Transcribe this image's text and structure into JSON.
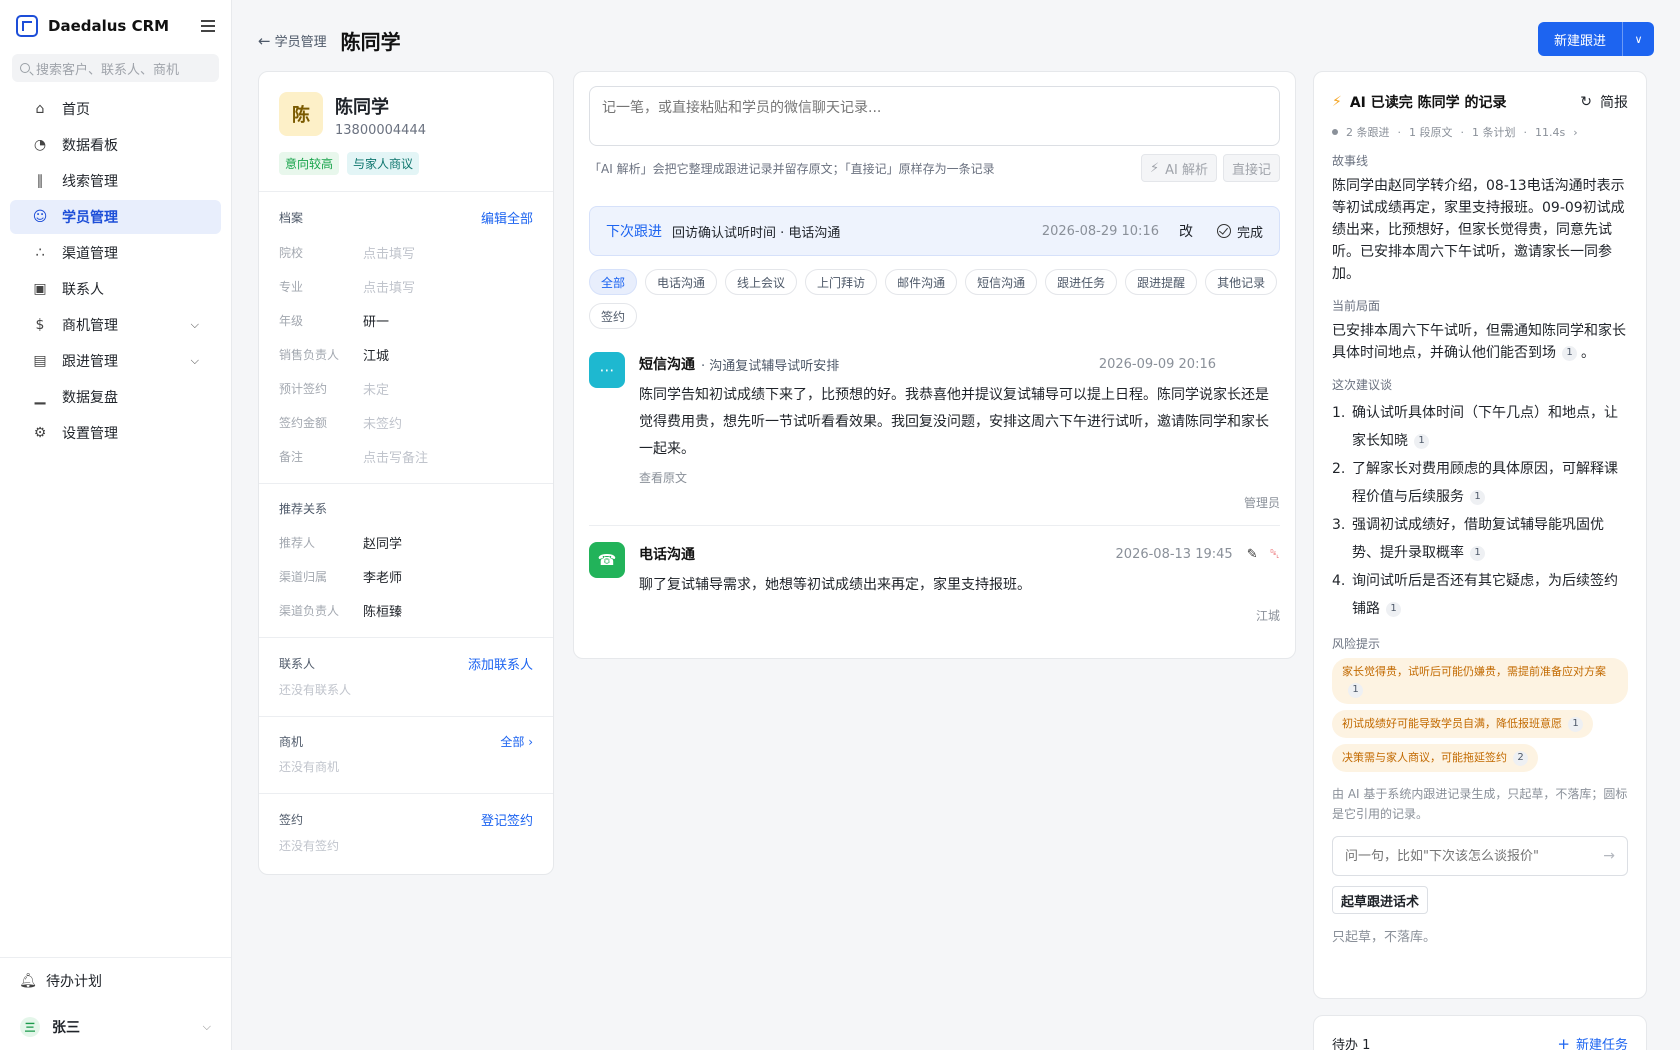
{
  "app": {
    "name": "Daedalus CRM"
  },
  "sidebar": {
    "search_placeholder": "搜索客户、联系人、商机",
    "items": [
      {
        "label": "首页",
        "icon": "home-icon"
      },
      {
        "label": "数据看板",
        "icon": "dashboard-icon"
      },
      {
        "label": "线索管理",
        "icon": "share-icon"
      },
      {
        "label": "学员管理",
        "icon": "users-icon",
        "active": true
      },
      {
        "label": "渠道管理",
        "icon": "network-icon"
      },
      {
        "label": "联系人",
        "icon": "contact-icon"
      },
      {
        "label": "商机管理",
        "icon": "dollar-icon",
        "expandable": true
      },
      {
        "label": "跟进管理",
        "icon": "clipboard-icon",
        "expandable": true
      },
      {
        "label": "数据复盘",
        "icon": "bar-chart-icon"
      },
      {
        "label": "设置管理",
        "icon": "gear-icon"
      }
    ],
    "todo_plan": "待办计划",
    "user": {
      "avatar": "三",
      "name": "张三"
    }
  },
  "header": {
    "back_label": "学员管理",
    "title": "陈同学",
    "new_button": "新建跟进"
  },
  "profile": {
    "avatar": "陈",
    "name": "陈同学",
    "phone": "13800004444",
    "tags": [
      "意向较高",
      "与家人商议"
    ],
    "archive": {
      "title": "档案",
      "edit_link": "编辑全部",
      "fields": [
        {
          "k": "院校",
          "v": "点击填写",
          "muted": true
        },
        {
          "k": "专业",
          "v": "点击填写",
          "muted": true
        },
        {
          "k": "年级",
          "v": "研一",
          "muted": false
        },
        {
          "k": "销售负责人",
          "v": "江城",
          "muted": false
        },
        {
          "k": "预计签约",
          "v": "未定",
          "muted": true
        },
        {
          "k": "签约金额",
          "v": "未签约",
          "muted": true
        },
        {
          "k": "备注",
          "v": "点击写备注",
          "muted": true
        }
      ]
    },
    "referral": {
      "title": "推荐关系",
      "fields": [
        {
          "k": "推荐人",
          "v": "赵同学"
        },
        {
          "k": "渠道归属",
          "v": "李老师"
        },
        {
          "k": "渠道负责人",
          "v": "陈桓臻"
        }
      ]
    },
    "contacts": {
      "title": "联系人",
      "link": "添加联系人",
      "empty": "还没有联系人"
    },
    "opportunities": {
      "title": "商机",
      "link": "全部 ›",
      "empty": "还没有商机"
    },
    "contracts": {
      "title": "签约",
      "link": "登记签约",
      "empty": "还没有签约"
    }
  },
  "composer": {
    "placeholder": "记一笔，或直接粘贴和学员的微信聊天记录...",
    "hint": "「AI 解析」会把它整理成跟进记录并留存原文；「直接记」原样存为一条记录",
    "ai_button": "AI 解析",
    "direct_button": "直接记"
  },
  "next_followup": {
    "label": "下次跟进",
    "text": "回访确认试听时间 · 电话沟通",
    "time": "2026-08-29 10:16",
    "edit": "改",
    "done": "完成"
  },
  "filters": [
    "全部",
    "电话沟通",
    "线上会议",
    "上门拜访",
    "邮件沟通",
    "短信沟通",
    "跟进任务",
    "跟进提醒",
    "其他记录",
    "签约"
  ],
  "records": [
    {
      "type": "短信沟通",
      "subtitle": "· 沟通复试辅导试听安排",
      "time": "2026-09-09 20:16",
      "text": "陈同学告知初试成绩下来了，比预想的好。我恭喜他并提议复试辅导可以提上日程。陈同学说家长还是觉得费用贵，想先听一节试听看看效果。我回复没问题，安排这周六下午进行试听，邀请陈同学和家长一起来。",
      "link": "查看原文",
      "author": "管理员"
    },
    {
      "type": "电话沟通",
      "subtitle": "",
      "time": "2026-08-13 19:45",
      "text": "聊了复试辅导需求，她想等初试成绩出来再定，家里支持报班。",
      "link": "",
      "author": "江城"
    }
  ],
  "ai": {
    "title": "AI 已读完 陈同学 的记录",
    "brief": "简报",
    "meta": [
      "2 条跟进",
      "·",
      "1 段原文",
      "·",
      "1 条计划",
      "·",
      "11.4s",
      "›"
    ],
    "storyline_title": "故事线",
    "storyline": "陈同学由赵同学转介绍，08-13电话沟通时表示等初试成绩再定，家里支持报班。09-09初试成绩出来，比预想好，但家长觉得贵，同意先试听。已安排本周六下午试听，邀请家长一同参加。",
    "situation_title": "当前局面",
    "situation": "已安排本周六下午试听，但需通知陈同学和家长具体时间地点，并确认他们能否到场",
    "situation_cite": "1",
    "situation_end": "。",
    "advice_title": "这次建议谈",
    "advice": [
      {
        "n": "1.",
        "text": "确认试听具体时间（下午几点）和地点，让家长知晓",
        "cite": "1"
      },
      {
        "n": "2.",
        "text": "了解家长对费用顾虑的具体原因，可解释课程价值与后续服务",
        "cite": "1"
      },
      {
        "n": "3.",
        "text": "强调初试成绩好，借助复试辅导能巩固优势、提升录取概率",
        "cite": "1"
      },
      {
        "n": "4.",
        "text": "询问试听后是否还有其它疑虑，为后续签约铺路",
        "cite": "1"
      }
    ],
    "risk_title": "风险提示",
    "risks": [
      {
        "text": "家长觉得贵，试听后可能仍嫌贵，需提前准备应对方案",
        "cite": "1"
      },
      {
        "text": "初试成绩好可能导致学员自满，降低报班意愿",
        "cite": "1"
      },
      {
        "text": "决策需与家人商议，可能拖延签约",
        "cite": "2"
      }
    ],
    "footnote": "由 AI 基于系统内跟进记录生成，只起草，不落库；圆标是它引用的记录。",
    "ask_placeholder": "问一句，比如\"下次该怎么谈报价\"",
    "draft_button": "起草跟进话术",
    "draft_note": "只起草，不落库。"
  },
  "todo": {
    "title": "待办 1",
    "new_task": "新建任务"
  }
}
